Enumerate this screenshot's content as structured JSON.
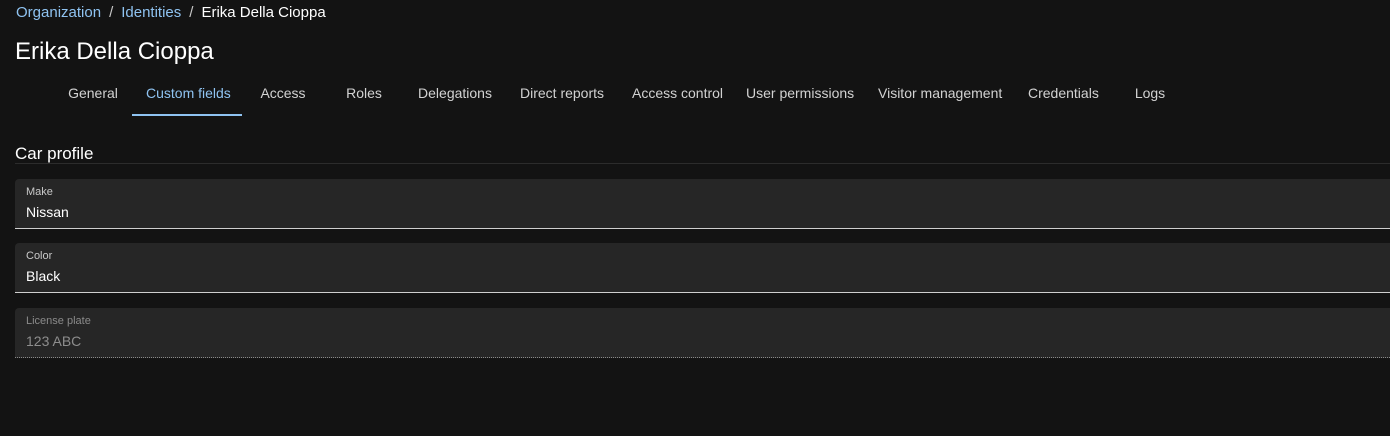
{
  "breadcrumb": {
    "items": [
      "Organization",
      "Identities"
    ],
    "separator": "/",
    "current": "Erika Della Cioppa"
  },
  "page": {
    "title": "Erika Della Cioppa"
  },
  "tabs": [
    {
      "label": "General",
      "active": false
    },
    {
      "label": "Custom fields",
      "active": true
    },
    {
      "label": "Access",
      "active": false
    },
    {
      "label": "Roles",
      "active": false
    },
    {
      "label": "Delegations",
      "active": false
    },
    {
      "label": "Direct reports",
      "active": false
    },
    {
      "label": "Access control",
      "active": false
    },
    {
      "label": "User permissions",
      "active": false
    },
    {
      "label": "Visitor management",
      "active": false
    },
    {
      "label": "Credentials",
      "active": false
    },
    {
      "label": "Logs",
      "active": false
    }
  ],
  "section": {
    "title": "Car profile",
    "fields": [
      {
        "label": "Make",
        "value": "Nissan",
        "disabled": false
      },
      {
        "label": "Color",
        "value": "Black",
        "disabled": false
      },
      {
        "label": "License plate",
        "value": "123 ABC",
        "disabled": true
      }
    ]
  },
  "colors": {
    "background": "#131313",
    "accent": "#8fc3f1",
    "field_background": "#262626",
    "text": "#ffffff"
  }
}
